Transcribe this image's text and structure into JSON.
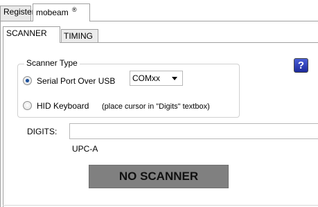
{
  "outer_tabs": [
    {
      "label": "Register",
      "active": false
    },
    {
      "label": "mobeam",
      "active": true,
      "close_symbol": "®"
    }
  ],
  "inner_tabs": [
    {
      "label": "SCANNER",
      "active": true
    },
    {
      "label": "TIMING",
      "active": false
    }
  ],
  "scanner_type": {
    "legend": "Scanner Type",
    "serial_label": "Serial Port Over USB",
    "serial_checked": true,
    "port_value": "COMxx",
    "hid_label": "HID Keyboard",
    "hid_note": "(place cursor in \"Digits\" textbox)",
    "hid_checked": false
  },
  "help_icon": "question-help-icon",
  "help_text": "?",
  "digits": {
    "label": "DIGITS:",
    "value": "",
    "symbology": "UPC-A"
  },
  "status": {
    "text": "NO SCANNER",
    "bg_color": "#808080"
  }
}
